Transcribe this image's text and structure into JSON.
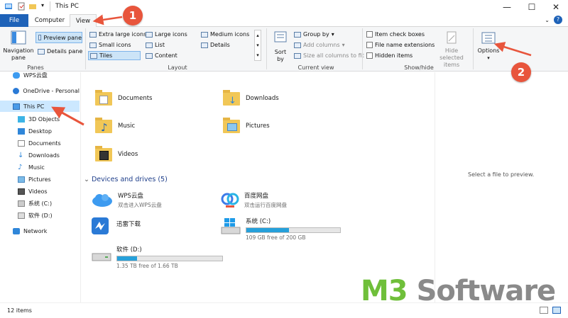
{
  "window": {
    "title": "This PC",
    "minimize": "—",
    "maximize": "☐",
    "close": "✕"
  },
  "tabs": {
    "file": "File",
    "computer": "Computer",
    "view": "View"
  },
  "ribbon": {
    "panes": {
      "group_label": "Panes",
      "navigation_pane": "Navigation pane",
      "preview_pane": "Preview pane",
      "details_pane": "Details pane"
    },
    "layout": {
      "group_label": "Layout",
      "extra_large_icons": "Extra large icons",
      "large_icons": "Large icons",
      "medium_icons": "Medium icons",
      "small_icons": "Small icons",
      "list": "List",
      "details": "Details",
      "tiles": "Tiles",
      "content": "Content"
    },
    "current_view": {
      "group_label": "Current view",
      "sort_by": "Sort by",
      "group_by": "Group by",
      "add_columns": "Add columns",
      "size_all_columns": "Size all columns to fit"
    },
    "show_hide": {
      "group_label": "Show/hide",
      "item_check_boxes": "Item check boxes",
      "file_name_extensions": "File name extensions",
      "hidden_items": "Hidden items",
      "hide_selected_items": "Hide selected items"
    },
    "options": {
      "label": "Options"
    }
  },
  "nav": {
    "items": [
      {
        "label": "WPS云盘"
      },
      {
        "label": "OneDrive - Personal"
      },
      {
        "label": "This PC"
      },
      {
        "label": "3D Objects"
      },
      {
        "label": "Desktop"
      },
      {
        "label": "Documents"
      },
      {
        "label": "Downloads"
      },
      {
        "label": "Music"
      },
      {
        "label": "Pictures"
      },
      {
        "label": "Videos"
      },
      {
        "label": "系统 (C:)"
      },
      {
        "label": "软件 (D:)"
      },
      {
        "label": "Network"
      }
    ]
  },
  "content": {
    "folders": [
      {
        "name": "Documents"
      },
      {
        "name": "Downloads"
      },
      {
        "name": "Music"
      },
      {
        "name": "Pictures"
      },
      {
        "name": "Videos"
      }
    ],
    "drives_header": "Devices and drives (5)",
    "drives": [
      {
        "name": "WPS云盘",
        "sub": "双击进入WPS云盘"
      },
      {
        "name": "百度网盘",
        "sub": "双击运行百度网盘"
      },
      {
        "name": "迅雷下载"
      },
      {
        "name": "系统 (C:)",
        "sub": "109 GB free of 200 GB",
        "used_fraction": 0.455
      },
      {
        "name": "软件 (D:)",
        "sub": "1.35 TB free of 1.66 TB",
        "used_fraction": 0.19
      }
    ]
  },
  "preview": {
    "text": "Select a file to preview."
  },
  "status": {
    "items": "12 items"
  },
  "callouts": {
    "one": "1",
    "two": "2"
  },
  "watermark": {
    "m3": "M3",
    "software": " Software"
  },
  "colors": {
    "accent": "#1e62b8",
    "callout": "#e8553c",
    "watermark_green": "#6fbf3a",
    "watermark_gray": "#8a8a8a"
  }
}
